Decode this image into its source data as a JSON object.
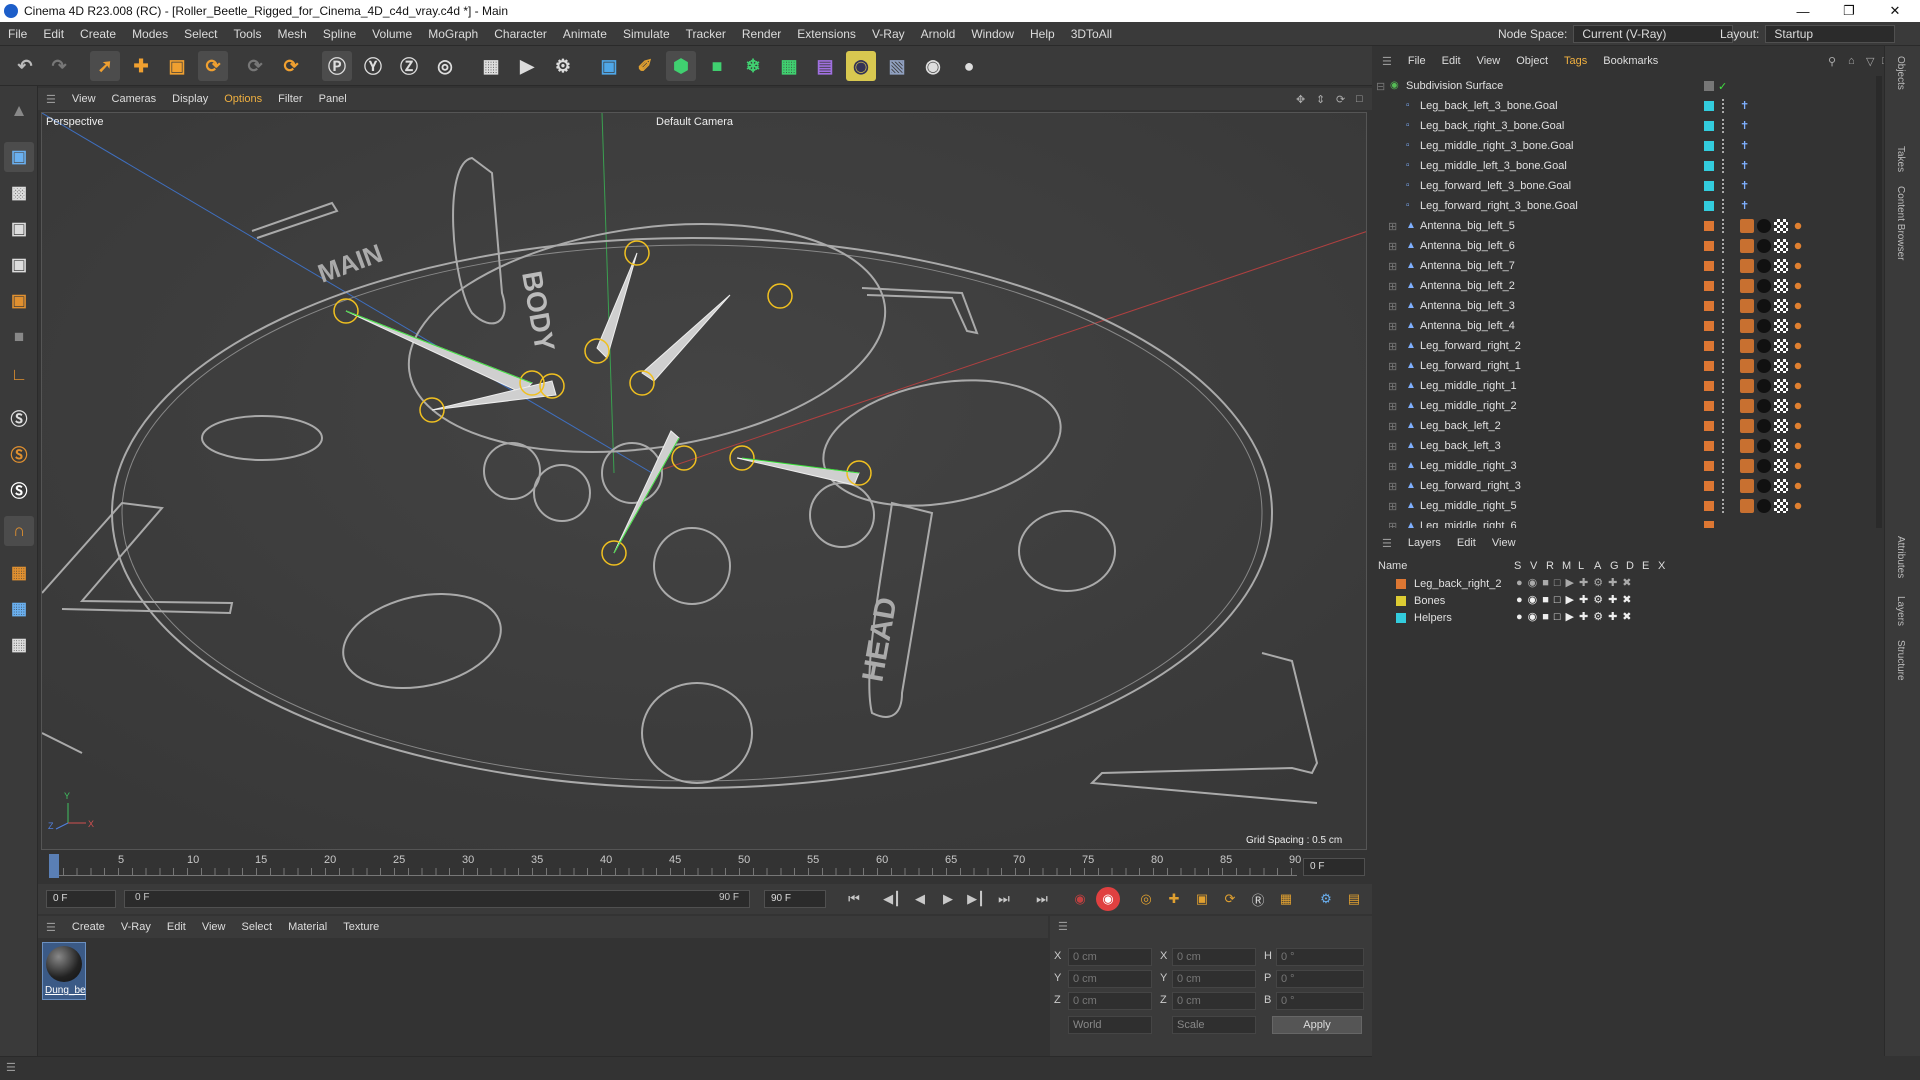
{
  "title": "Cinema 4D R23.008 (RC) - [Roller_Beetle_Rigged_for_Cinema_4D_c4d_vray.c4d *] - Main",
  "menu": [
    "File",
    "Edit",
    "Create",
    "Modes",
    "Select",
    "Tools",
    "Mesh",
    "Spline",
    "Volume",
    "MoGraph",
    "Character",
    "Animate",
    "Simulate",
    "Tracker",
    "Render",
    "Extensions",
    "V-Ray",
    "Arnold",
    "Window",
    "Help",
    "3DToAll"
  ],
  "node_space_label": "Node Space:",
  "node_space_value": "Current (V-Ray)",
  "layout_label": "Layout:",
  "layout_value": "Startup",
  "viewport_menu": [
    "View",
    "Cameras",
    "Display",
    "Options",
    "Filter",
    "Panel"
  ],
  "viewport": {
    "name": "Perspective",
    "camera": "Default Camera",
    "grid_spacing": "Grid Spacing : 0.5 cm"
  },
  "timeline": {
    "ticks": [
      "0",
      "5",
      "10",
      "15",
      "20",
      "25",
      "30",
      "35",
      "40",
      "45",
      "50",
      "55",
      "60",
      "65",
      "70",
      "75",
      "80",
      "85",
      "90"
    ],
    "current_frame": "0 F"
  },
  "transport": {
    "start": "0 F",
    "range_start": "0 F",
    "range_end": "90 F",
    "end": "90 F"
  },
  "material_menu": [
    "Create",
    "V-Ray",
    "Edit",
    "View",
    "Select",
    "Material",
    "Texture"
  ],
  "material": {
    "name": "Dung_be"
  },
  "coords": {
    "x_pos": "0 cm",
    "y_pos": "0 cm",
    "z_pos": "0 cm",
    "x_size": "0 cm",
    "y_size": "0 cm",
    "z_size": "0 cm",
    "h": "0 °",
    "p": "0 °",
    "b": "0 °",
    "mode": "World",
    "size_mode": "Scale",
    "apply": "Apply"
  },
  "objects_menu": [
    "File",
    "Edit",
    "View",
    "Object",
    "Tags",
    "Bookmarks"
  ],
  "objects": [
    {
      "name": "Subdivision Surface",
      "color": "#55bb55",
      "kind": "root"
    },
    {
      "name": "Leg_back_left_3_bone.Goal",
      "color": "#33ccdd",
      "kind": "goal"
    },
    {
      "name": "Leg_back_right_3_bone.Goal",
      "color": "#33ccdd",
      "kind": "goal"
    },
    {
      "name": "Leg_middle_right_3_bone.Goal",
      "color": "#33ccdd",
      "kind": "goal"
    },
    {
      "name": "Leg_middle_left_3_bone.Goal",
      "color": "#33ccdd",
      "kind": "goal"
    },
    {
      "name": "Leg_forward_left_3_bone.Goal",
      "color": "#33ccdd",
      "kind": "goal"
    },
    {
      "name": "Leg_forward_right_3_bone.Goal",
      "color": "#33ccdd",
      "kind": "goal"
    },
    {
      "name": "Antenna_big_left_5",
      "color": "#dd7733",
      "kind": "bone"
    },
    {
      "name": "Antenna_big_left_6",
      "color": "#dd7733",
      "kind": "bone"
    },
    {
      "name": "Antenna_big_left_7",
      "color": "#dd7733",
      "kind": "bone"
    },
    {
      "name": "Antenna_big_left_2",
      "color": "#dd7733",
      "kind": "bone"
    },
    {
      "name": "Antenna_big_left_3",
      "color": "#dd7733",
      "kind": "bone"
    },
    {
      "name": "Antenna_big_left_4",
      "color": "#dd7733",
      "kind": "bone"
    },
    {
      "name": "Leg_forward_right_2",
      "color": "#dd7733",
      "kind": "bone"
    },
    {
      "name": "Leg_forward_right_1",
      "color": "#dd7733",
      "kind": "bone"
    },
    {
      "name": "Leg_middle_right_1",
      "color": "#dd7733",
      "kind": "bone"
    },
    {
      "name": "Leg_middle_right_2",
      "color": "#dd7733",
      "kind": "bone"
    },
    {
      "name": "Leg_back_left_2",
      "color": "#dd7733",
      "kind": "bone"
    },
    {
      "name": "Leg_back_left_3",
      "color": "#dd7733",
      "kind": "bone"
    },
    {
      "name": "Leg_middle_right_3",
      "color": "#dd7733",
      "kind": "bone"
    },
    {
      "name": "Leg_forward_right_3",
      "color": "#dd7733",
      "kind": "bone"
    },
    {
      "name": "Leg_middle_right_5",
      "color": "#dd7733",
      "kind": "bone"
    },
    {
      "name": "Leg_middle_right_6",
      "color": "#dd7733",
      "kind": "bone"
    }
  ],
  "layers_menu": [
    "Layers",
    "Edit",
    "View"
  ],
  "layers_header": {
    "name": "Name",
    "cols": [
      "S",
      "V",
      "R",
      "M",
      "L",
      "A",
      "G",
      "D",
      "E",
      "X"
    ]
  },
  "layers": [
    {
      "name": "Leg_back_right_2",
      "color": "#dd7733"
    },
    {
      "name": "Bones",
      "color": "#ddcc33"
    },
    {
      "name": "Helpers",
      "color": "#33ccdd"
    }
  ],
  "side_tabs": [
    "Objects",
    "Takes",
    "Content Browser",
    "Attributes",
    "Layers",
    "Structure"
  ],
  "viewport_labels": {
    "body": "BODY",
    "main": "MAIN",
    "head": "HEAD",
    "axis_x": "X",
    "axis_y": "Y",
    "axis_z": "Z"
  }
}
